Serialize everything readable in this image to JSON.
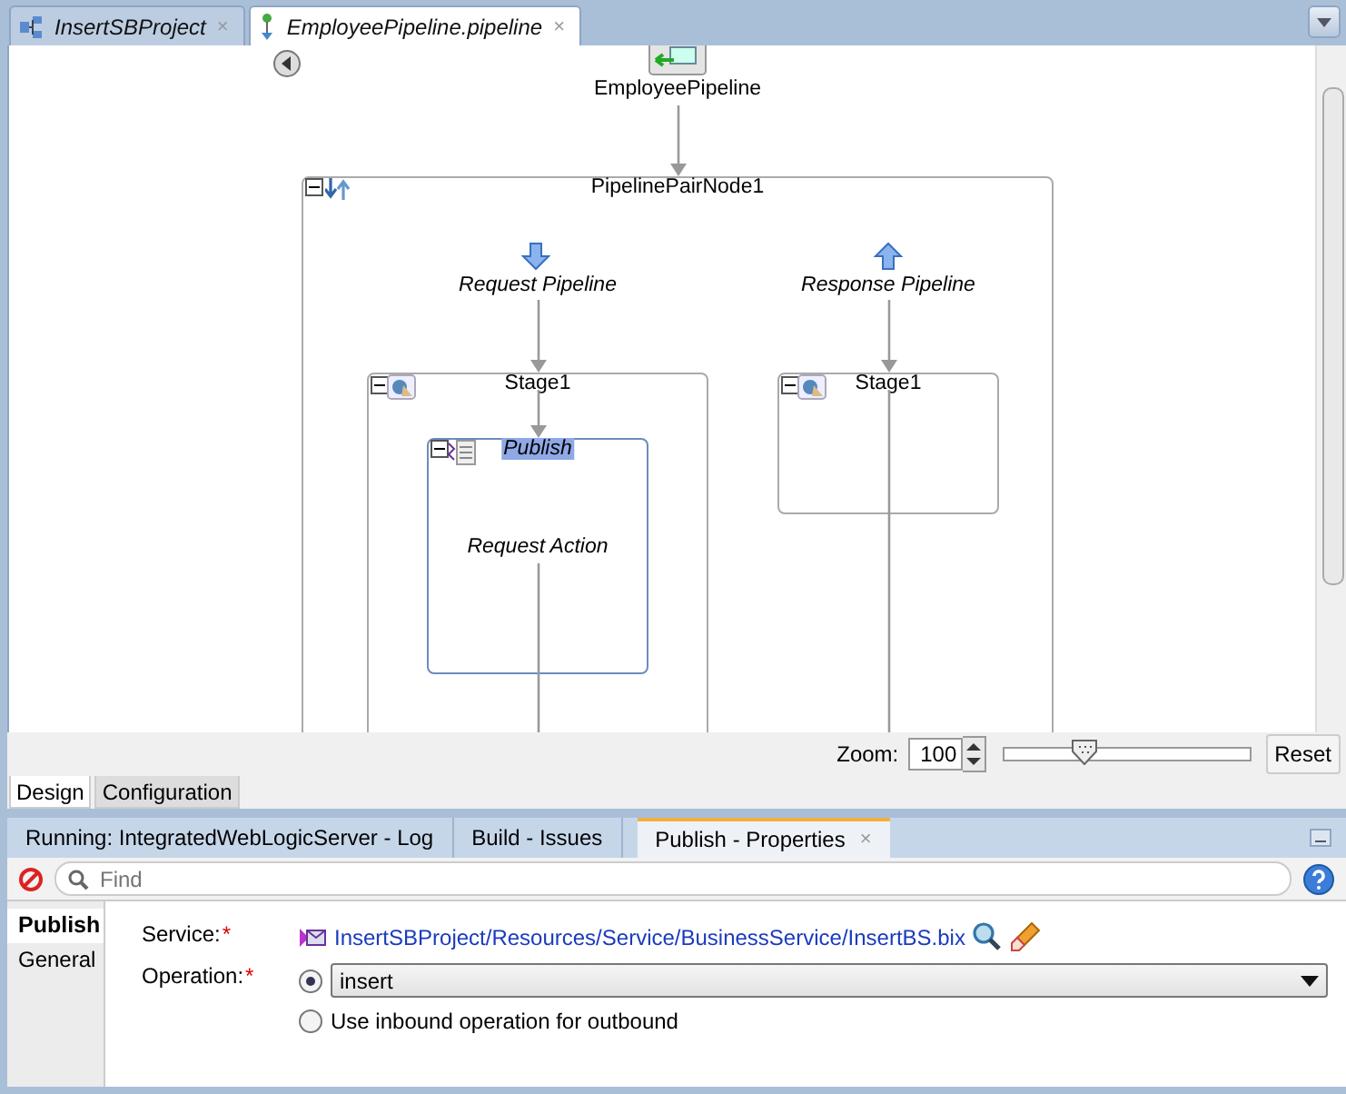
{
  "editor_tabs": [
    {
      "label": "InsertSBProject",
      "close": "×",
      "selected": false
    },
    {
      "label": "EmployeePipeline.pipeline",
      "close": "×",
      "selected": true
    }
  ],
  "diagram": {
    "pipeline": "EmployeePipeline",
    "pair_node": "PipelinePairNode1",
    "request": {
      "label": "Request Pipeline",
      "stage": "Stage1",
      "action": {
        "label": "Publish",
        "selected": true,
        "text": "Request Action"
      }
    },
    "response": {
      "label": "Response Pipeline",
      "stage": "Stage1"
    }
  },
  "zoom": {
    "label": "Zoom:",
    "value": "100",
    "level": 0.33,
    "reset": "Reset"
  },
  "view_tabs": [
    {
      "label": "Design",
      "selected": true
    },
    {
      "label": "Configuration",
      "selected": false
    }
  ],
  "panel_tabs": [
    {
      "label": "Running: IntegratedWebLogicServer - Log",
      "selected": false
    },
    {
      "label": "Build - Issues",
      "selected": false
    },
    {
      "label": "Publish - Properties",
      "close": "×",
      "selected": true
    }
  ],
  "find": {
    "placeholder": "Find"
  },
  "property_tabs": [
    {
      "label": "Publish",
      "selected": true
    },
    {
      "label": "General",
      "selected": false
    }
  ],
  "service": {
    "label": "Service:",
    "required_mark": "*",
    "value": "InsertSBProject/Resources/Service/BusinessService/InsertBS.bix"
  },
  "operation": {
    "label": "Operation:",
    "required_mark": "*",
    "options": [
      {
        "kind": "select",
        "selected": true,
        "value": "insert"
      },
      {
        "kind": "label",
        "selected": false,
        "label": "Use inbound operation for outbound"
      }
    ]
  }
}
